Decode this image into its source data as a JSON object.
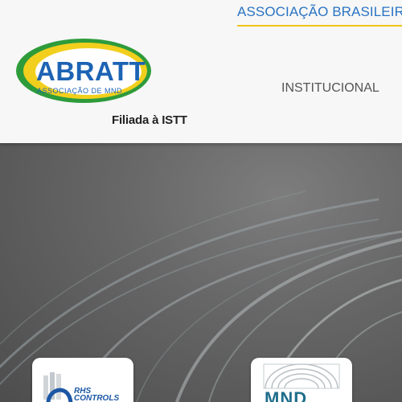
{
  "header": {
    "tagline": "ASSOCIAÇÃO BRASILEIR",
    "logo": {
      "acronym": "ABRATT",
      "subtitle": "ASSOCIAÇÃO DE MND"
    },
    "affiliation": "Filiada à ISTT",
    "nav": [
      {
        "label": "INSTITUCIONAL"
      }
    ]
  },
  "sponsors": [
    {
      "label_line1": "RHS",
      "label_line2": "CONTROLS"
    },
    {
      "label": "MND"
    }
  ],
  "colors": {
    "brand_blue": "#1d63b4",
    "brand_yellow": "#f0c419",
    "brand_green": "#2e9b3b",
    "tagline_blue": "#2a73c2"
  }
}
